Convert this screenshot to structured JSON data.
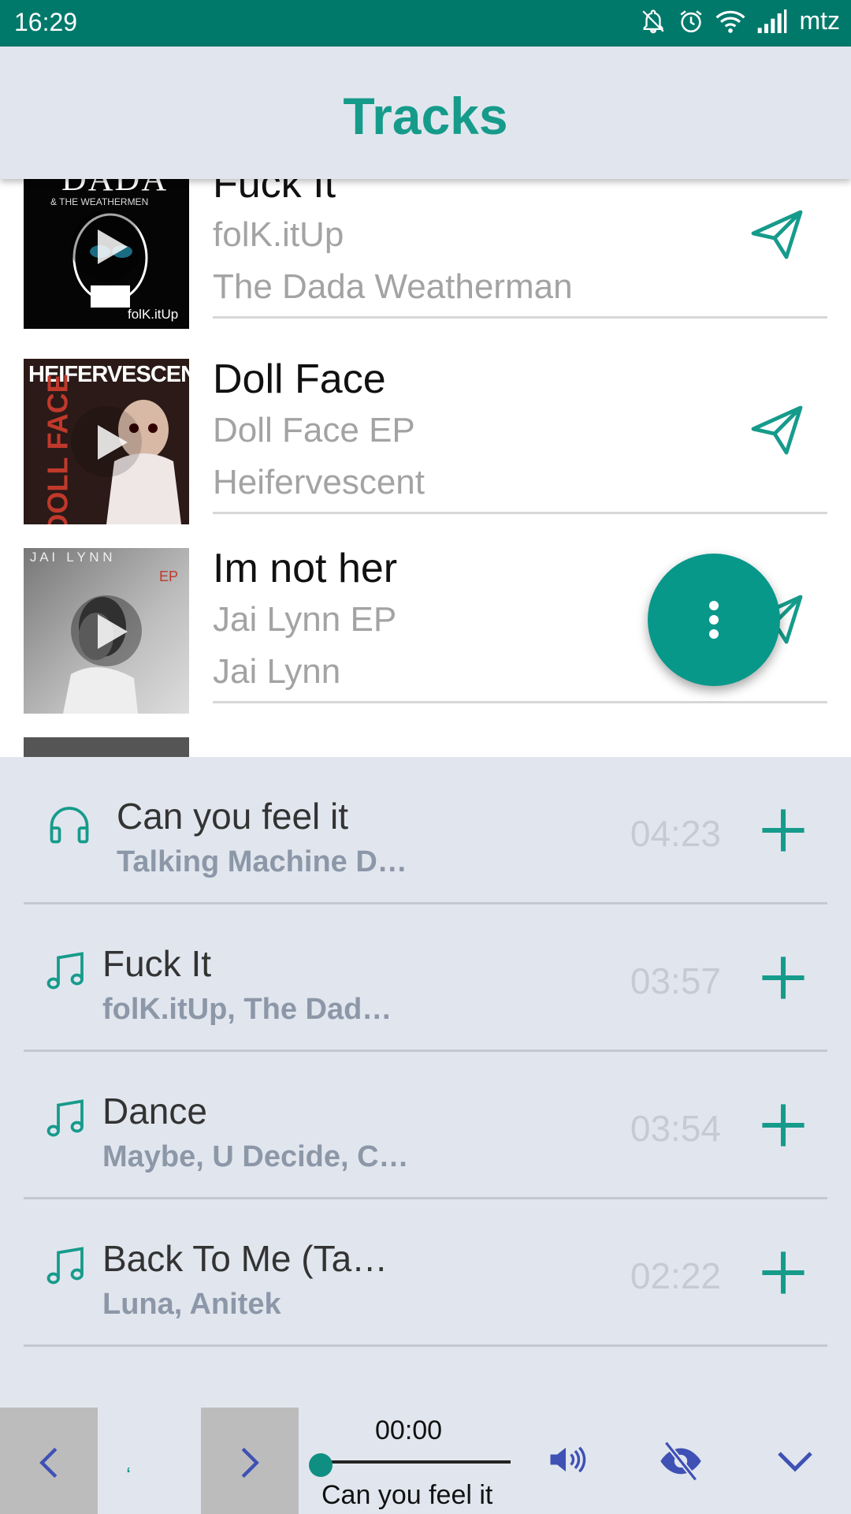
{
  "status_bar": {
    "time": "16:29",
    "carrier": "mtz"
  },
  "app_bar": {
    "title": "Tracks"
  },
  "tracks": [
    {
      "title": "Fuck It",
      "album": "folK.itUp",
      "artist": "The Dada Weatherman",
      "cover_text": "DADA",
      "cover_sub": "& THE WEATHERMEN",
      "cover_tag": "folK.itUp"
    },
    {
      "title": "Doll Face",
      "album": "Doll Face EP",
      "artist": "Heifervescent",
      "cover_text": "HEIFERVESCENT",
      "cover_side": "DOLL FACE"
    },
    {
      "title": "Im not her",
      "album": "Jai Lynn EP",
      "artist": "Jai Lynn",
      "cover_text": "J A I   L Y N N",
      "cover_tag": "EP"
    }
  ],
  "queue": [
    {
      "title": "Can you feel it",
      "artists": "Talking Machine D…",
      "duration": "04:23",
      "icon": "headphones-icon"
    },
    {
      "title": "Fuck It",
      "artists": "folK.itUp, The Dad…",
      "duration": "03:57",
      "icon": "music-note-icon"
    },
    {
      "title": "Dance",
      "artists": "Maybe, U Decide, C…",
      "duration": "03:54",
      "icon": "music-note-icon"
    },
    {
      "title": "Back To Me (Ta…",
      "artists": "Luna, Anitek",
      "duration": "02:22",
      "icon": "music-note-icon"
    }
  ],
  "player": {
    "elapsed": "00:00",
    "now_playing": "Can you feel it",
    "progress": 0
  },
  "colors": {
    "status_bar": "#00796b",
    "accent": "#169b8b",
    "fab": "#08988a",
    "control_icons": "#3f51b5",
    "background": "#e1e6ee"
  }
}
